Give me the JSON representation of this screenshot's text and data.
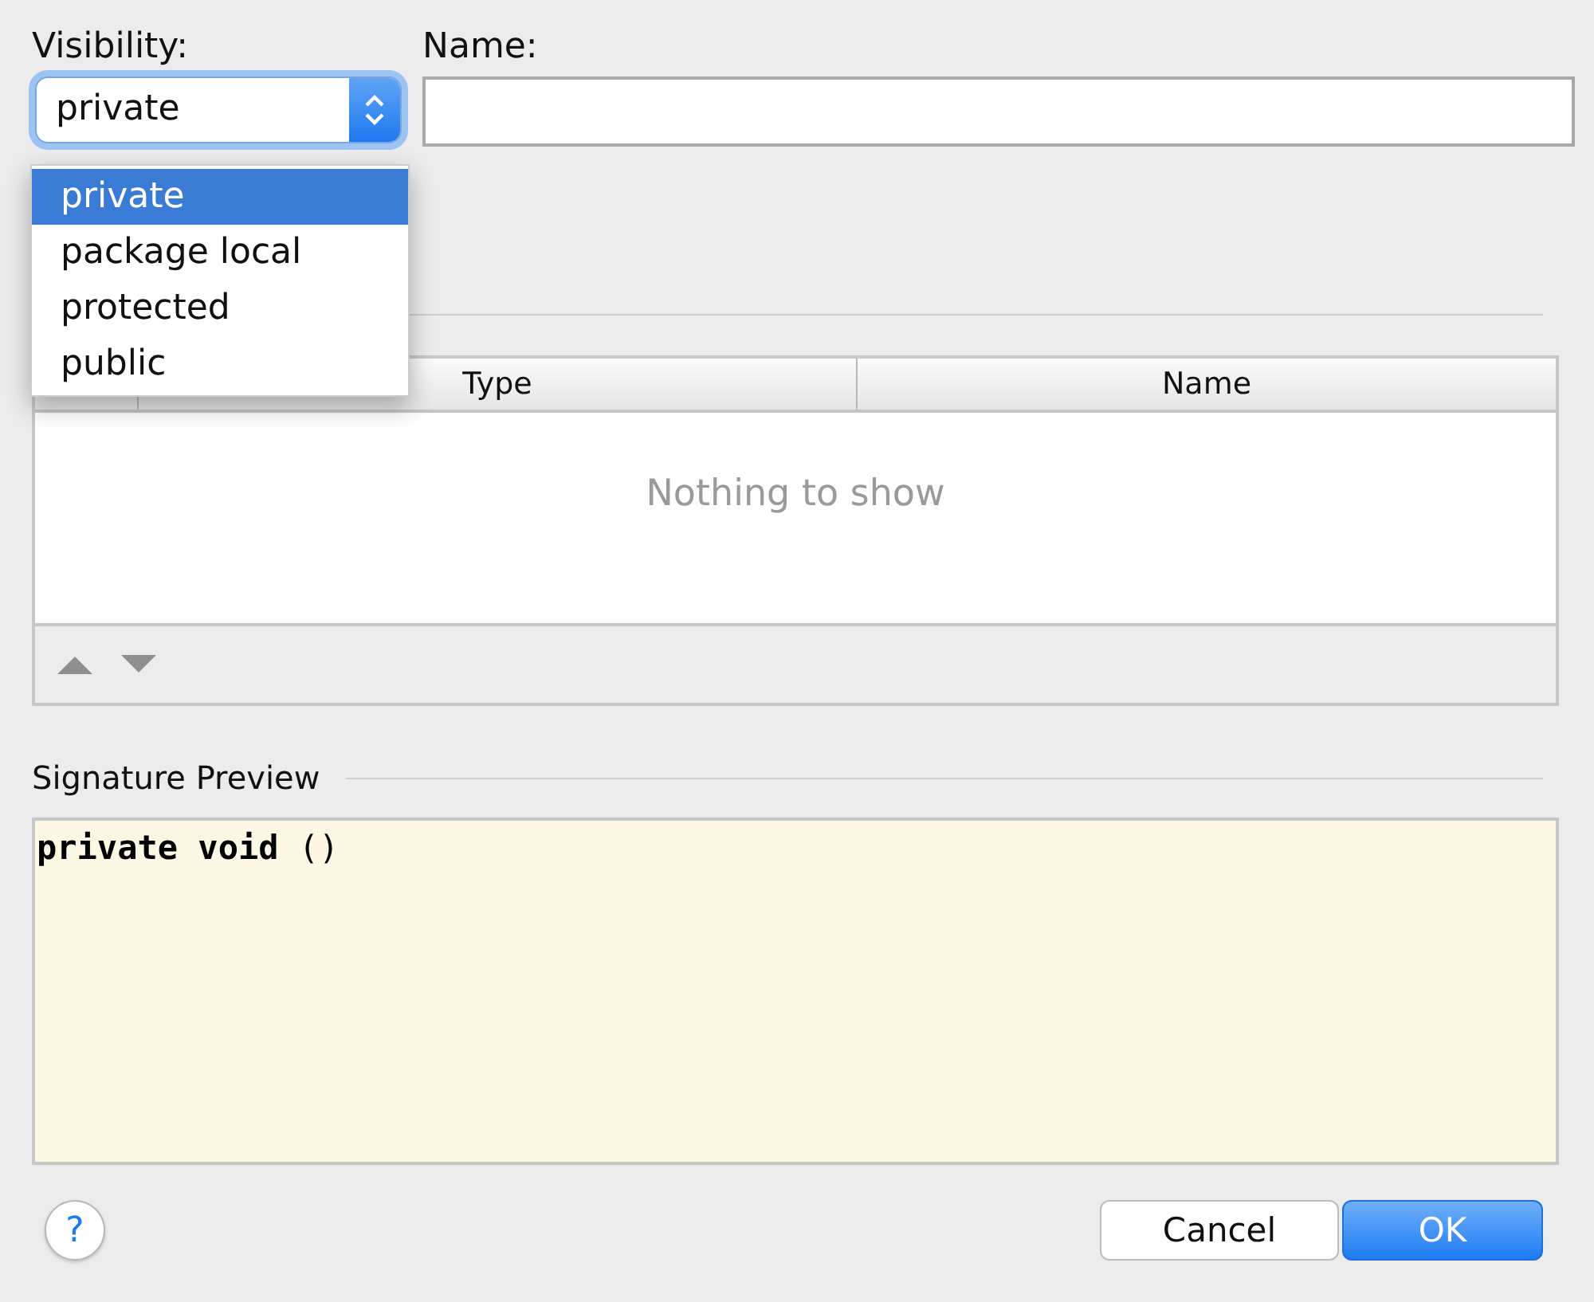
{
  "visibility": {
    "label": "Visibility:",
    "value": "private",
    "open": true,
    "options": [
      {
        "label": "private",
        "selected": true
      },
      {
        "label": "package local",
        "selected": false
      },
      {
        "label": "protected",
        "selected": false
      },
      {
        "label": "public",
        "selected": false
      }
    ]
  },
  "name": {
    "label": "Name:"
  },
  "parameters": {
    "columns": [
      "Type",
      "Name"
    ],
    "empty_text": "Nothing to show"
  },
  "signature_preview": {
    "title": "Signature Preview",
    "code": "**private** **void** ()"
  },
  "help": {
    "label": "?"
  },
  "buttons": [
    {
      "label": "Cancel",
      "kind": "secondary"
    },
    {
      "label": "OK",
      "kind": "primary"
    }
  ]
}
